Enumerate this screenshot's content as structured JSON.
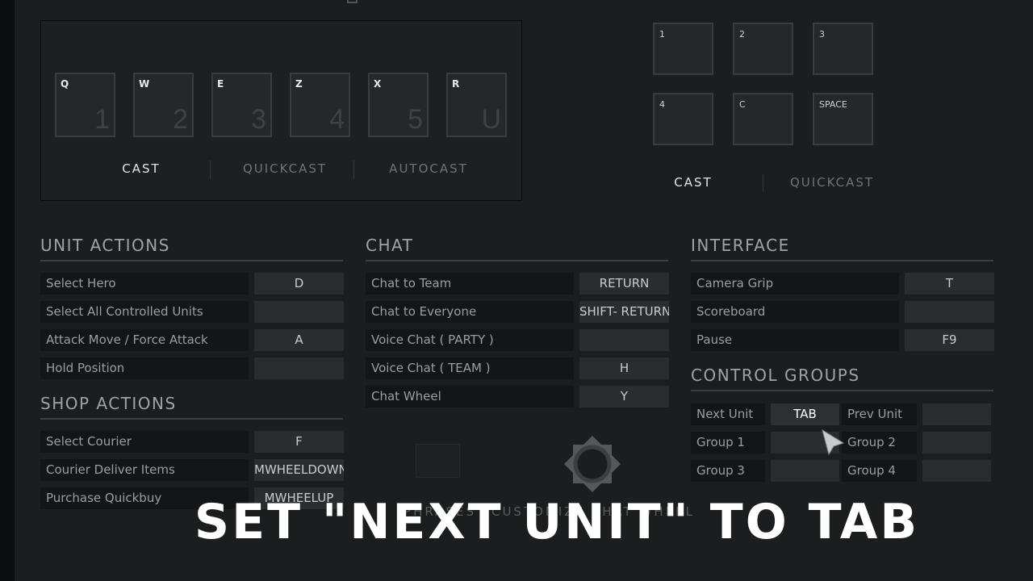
{
  "abilities": {
    "keys": [
      {
        "key": "Q",
        "slot": "1"
      },
      {
        "key": "W",
        "slot": "2"
      },
      {
        "key": "E",
        "slot": "3"
      },
      {
        "key": "Z",
        "slot": "4"
      },
      {
        "key": "X",
        "slot": "5"
      },
      {
        "key": "R",
        "slot": "U"
      }
    ],
    "tabs": [
      "CAST",
      "QUICKCAST",
      "AUTOCAST"
    ],
    "active_tab": "CAST"
  },
  "items": {
    "keys": [
      "1",
      "2",
      "3",
      "4",
      "C",
      "SPACE"
    ],
    "tabs": [
      "CAST",
      "QUICKCAST"
    ],
    "active_tab": "CAST"
  },
  "unit_actions": {
    "title": "UNIT ACTIONS",
    "rows": [
      {
        "label": "Select Hero",
        "key": "D"
      },
      {
        "label": "Select All Controlled Units",
        "key": ""
      },
      {
        "label": "Attack Move / Force Attack",
        "key": "A"
      },
      {
        "label": "Hold Position",
        "key": ""
      }
    ]
  },
  "shop_actions": {
    "title": "SHOP ACTIONS",
    "rows": [
      {
        "label": "Select Courier",
        "key": "F"
      },
      {
        "label": "Courier Deliver Items",
        "key": "MWHEELDOWN"
      },
      {
        "label": "Purchase Quickbuy",
        "key": "MWHEELUP"
      }
    ]
  },
  "chat": {
    "title": "CHAT",
    "rows": [
      {
        "label": "Chat to Team",
        "key": "RETURN"
      },
      {
        "label": "Chat to Everyone",
        "key": "SHIFT- RETURN"
      },
      {
        "label": "Voice Chat ( PARTY )",
        "key": ""
      },
      {
        "label": "Voice Chat ( TEAM )",
        "key": "H"
      },
      {
        "label": "Chat Wheel",
        "key": "Y"
      }
    ],
    "phrases_label": "PHRASES",
    "customize_label": "CUSTOMIZE CHAT WHEEL"
  },
  "interface": {
    "title": "INTERFACE",
    "rows": [
      {
        "label": "Camera Grip",
        "key": "T"
      },
      {
        "label": "Scoreboard",
        "key": ""
      },
      {
        "label": "Pause",
        "key": "F9"
      }
    ]
  },
  "control_groups": {
    "title": "CONTROL GROUPS",
    "rows": [
      [
        {
          "label": "Next Unit",
          "key": "TAB"
        },
        {
          "label": "Prev Unit",
          "key": ""
        }
      ],
      [
        {
          "label": "Group 1",
          "key": ""
        },
        {
          "label": "Group 2",
          "key": ""
        }
      ],
      [
        {
          "label": "Group 3",
          "key": ""
        },
        {
          "label": "Group 4",
          "key": ""
        }
      ]
    ]
  },
  "caption": "SET \"NEXT UNIT\" TO TAB"
}
